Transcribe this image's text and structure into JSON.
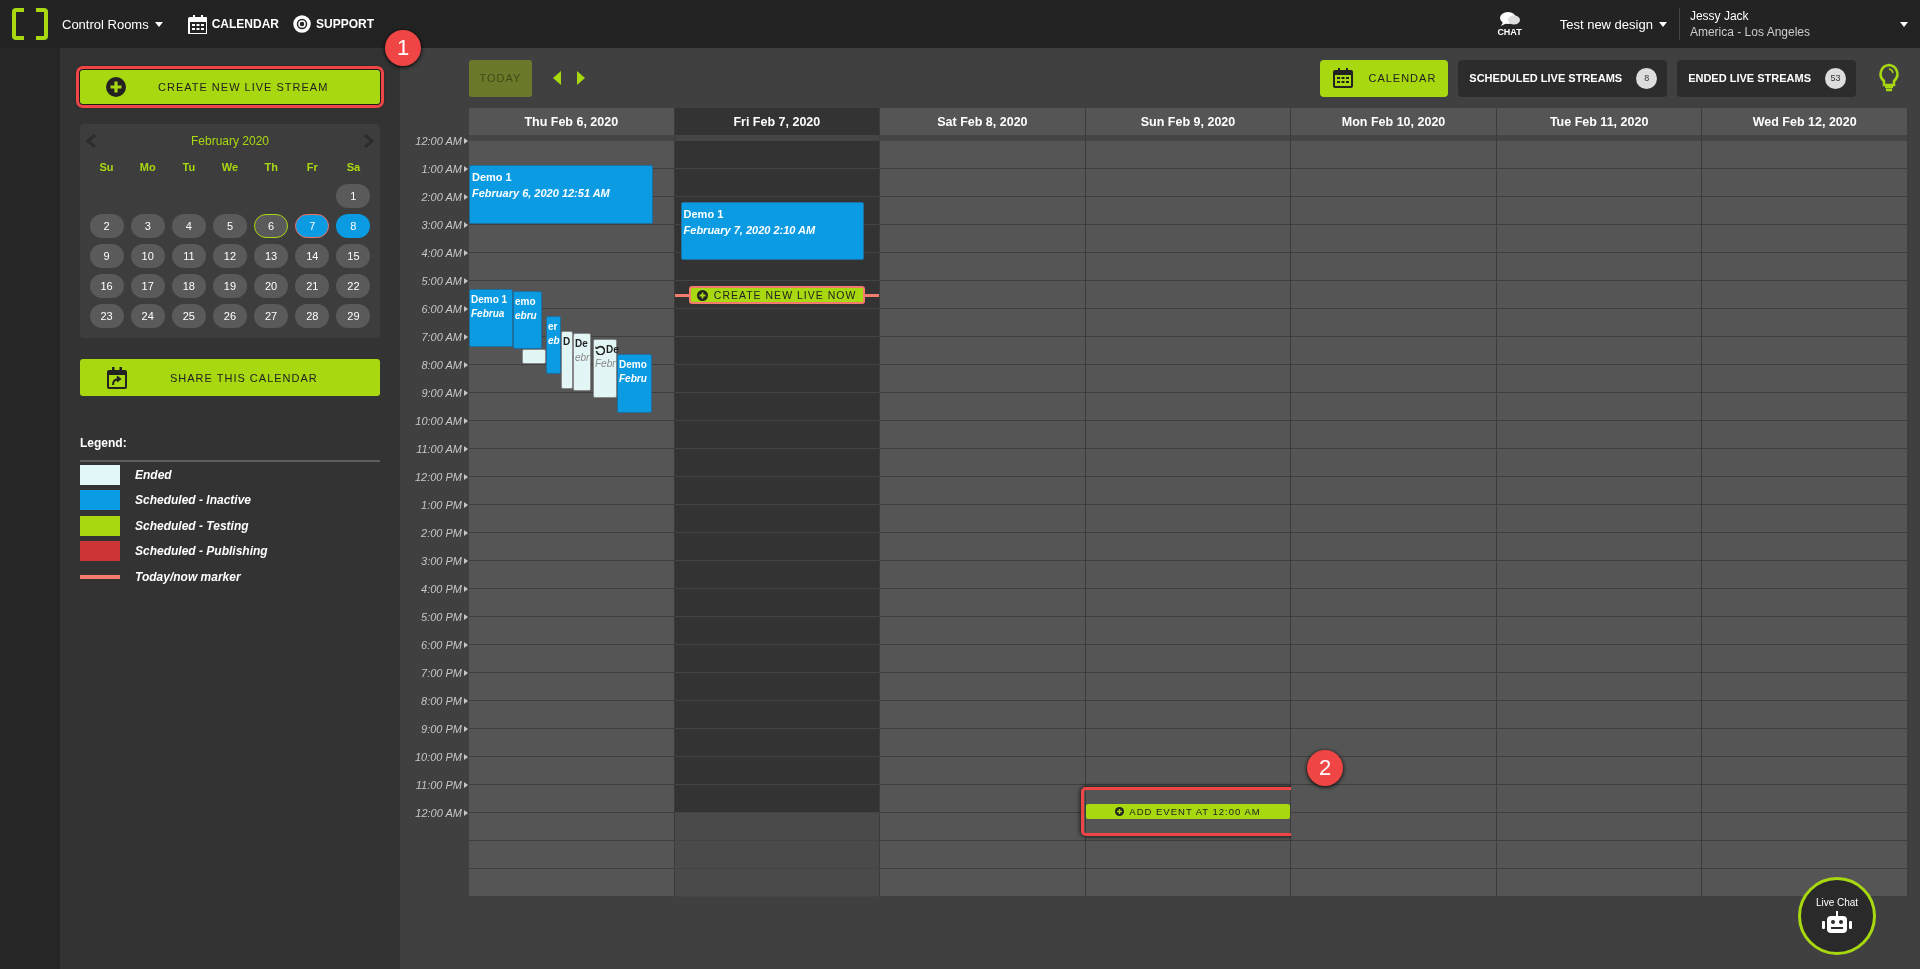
{
  "topbar": {
    "menu": "Control Rooms",
    "nav": [
      {
        "label": "CALENDAR",
        "kind": "calendar"
      },
      {
        "label": "SUPPORT",
        "kind": "support"
      }
    ],
    "chat": "CHAT",
    "design_menu": "Test new design",
    "user": {
      "name": "Jessy Jack",
      "location": "America - Los Angeles"
    }
  },
  "sidebar": {
    "create_button": {
      "label": "CREATE NEW LIVE STREAM",
      "highlighted": true
    },
    "mini_calendar": {
      "month": "February 2020",
      "weekdays": [
        "Su",
        "Mo",
        "Tu",
        "We",
        "Th",
        "Fr",
        "Sa"
      ],
      "weeks": [
        [
          {
            "label": "1",
            "selected": false
          }
        ],
        [
          {
            "label": "2",
            "selected": false
          },
          {
            "label": "3",
            "selected": false
          },
          {
            "label": "4",
            "selected": false
          },
          {
            "label": "5",
            "selected": false
          },
          {
            "label": "6",
            "selected": false,
            "color": "#a8d810"
          },
          {
            "label": "7",
            "selected": true,
            "color": "#f07060"
          },
          {
            "label": "8",
            "selected": true
          }
        ],
        [
          {
            "label": "9",
            "selected": false
          },
          {
            "label": "10",
            "selected": false
          },
          {
            "label": "11",
            "selected": false
          },
          {
            "label": "12",
            "selected": false
          },
          {
            "label": "13",
            "selected": false
          },
          {
            "label": "14",
            "selected": false
          },
          {
            "label": "15",
            "selected": false
          }
        ],
        [
          {
            "label": "16",
            "selected": false
          },
          {
            "label": "17",
            "selected": false
          },
          {
            "label": "18",
            "selected": false
          },
          {
            "label": "19",
            "selected": false
          },
          {
            "label": "20",
            "selected": false
          },
          {
            "label": "21",
            "selected": false
          },
          {
            "label": "22",
            "selected": false
          }
        ],
        [
          {
            "label": "23",
            "selected": false
          },
          {
            "label": "24",
            "selected": false
          },
          {
            "label": "25",
            "selected": false
          },
          {
            "label": "26",
            "selected": false
          },
          {
            "label": "27",
            "selected": false
          },
          {
            "label": "28",
            "selected": false
          },
          {
            "label": "29",
            "selected": false
          }
        ]
      ]
    },
    "share_button": "SHARE THIS CALENDAR",
    "legend": {
      "title": "Legend:",
      "items": [
        {
          "kind": "swatch",
          "color": "#e2f7f7",
          "label": "Ended"
        },
        {
          "kind": "swatch",
          "color": "#0a9be3",
          "label": "Scheduled - Inactive"
        },
        {
          "kind": "swatch",
          "color": "#a8d810",
          "label": "Scheduled - Testing"
        },
        {
          "kind": "swatch",
          "color": "#cc3535",
          "label": "Scheduled - Publishing"
        },
        {
          "kind": "line",
          "color": "#f47c6c",
          "label": "Today/now marker"
        }
      ]
    }
  },
  "toolbar": {
    "today_button": {
      "label": "TODAY",
      "disabled": true
    },
    "views": [
      {
        "label": "CALENDAR",
        "selected": true
      },
      {
        "label": "SCHEDULED LIVE STREAMS",
        "count": "8",
        "selected": false
      },
      {
        "label": "ENDED LIVE STREAMS",
        "count": "53",
        "selected": false
      }
    ]
  },
  "week": {
    "times": [
      "12:00 AM",
      "1:00 AM",
      "2:00 AM",
      "3:00 AM",
      "4:00 AM",
      "5:00 AM",
      "6:00 AM",
      "7:00 AM",
      "8:00 AM",
      "9:00 AM",
      "10:00 AM",
      "11:00 AM",
      "12:00 PM",
      "1:00 PM",
      "2:00 PM",
      "3:00 PM",
      "4:00 PM",
      "5:00 PM",
      "6:00 PM",
      "7:00 PM",
      "8:00 PM",
      "9:00 PM",
      "10:00 PM",
      "11:00 PM",
      "12:00 AM"
    ],
    "days": [
      {
        "label": "Thu Feb 6, 2020",
        "today": false,
        "events": [
          {
            "kind": "scheduled-inactive",
            "title": "Demo 1",
            "subtitle": "February 6, 2020 12:51 AM",
            "repeat": false
          },
          {
            "kind": "scheduled-inactive",
            "title": "Demo 1",
            "subtitle": "Februa",
            "repeat": false
          },
          {
            "kind": "scheduled-inactive",
            "title": "emo",
            "subtitle": "ebru",
            "repeat": false
          },
          {
            "kind": "ended",
            "repeat": false
          },
          {
            "kind": "scheduled-inactive",
            "title": "er",
            "subtitle": "eb",
            "repeat": false
          },
          {
            "kind": "ended",
            "title": "D",
            "repeat": false
          },
          {
            "kind": "ended",
            "title": "De",
            "subtitle": "ebr",
            "repeat": false
          },
          {
            "kind": "ended",
            "title": "De",
            "subtitle": "Febr",
            "repeat": true
          },
          {
            "kind": "scheduled-inactive",
            "title": "Demo",
            "subtitle": "Febru",
            "repeat": false
          }
        ]
      },
      {
        "label": "Fri Feb 7, 2020",
        "today": true,
        "now_button": "CREATE NEW LIVE NOW",
        "events": [
          {
            "kind": "scheduled-inactive",
            "title": "Demo 1",
            "subtitle": "February 7, 2020 2:10 AM",
            "repeat": false
          }
        ]
      },
      {
        "label": "Sat Feb 8, 2020",
        "today": false
      },
      {
        "label": "Sun Feb 9, 2020",
        "today": false,
        "add_event": {
          "label": "ADD EVENT AT 12:00 AM",
          "highlighted": true
        }
      },
      {
        "label": "Mon Feb 10, 2020",
        "today": false
      },
      {
        "label": "Tue Feb 11, 2020",
        "today": false
      },
      {
        "label": "Wed Feb 12, 2020",
        "today": false
      }
    ]
  },
  "callouts": [
    {
      "label": "1"
    },
    {
      "label": "2"
    }
  ],
  "live_chat": {
    "label": "Live Chat"
  }
}
